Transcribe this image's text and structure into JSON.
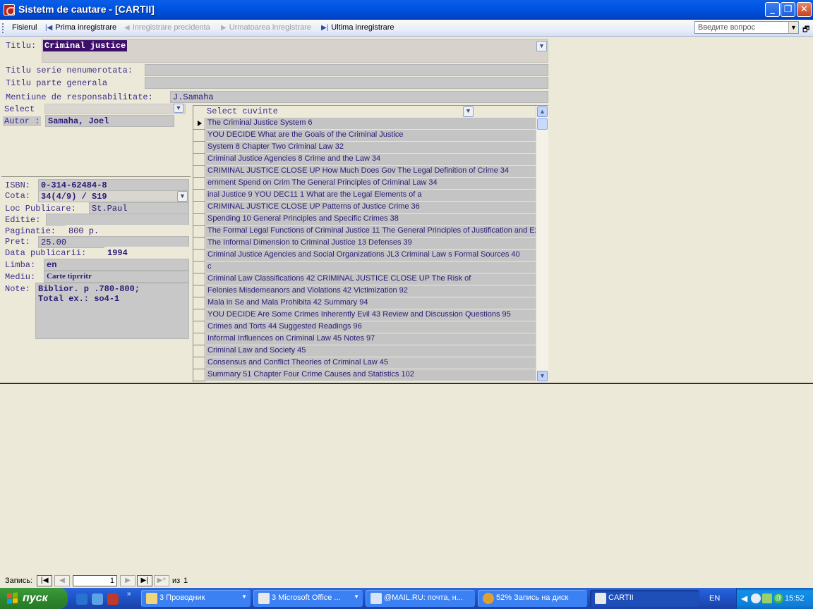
{
  "window": {
    "title": "Sistetm de cautare - [CARTII]"
  },
  "menu": {
    "fisierul": "Fisierul",
    "prima": "Prima inregistrare",
    "precedenta": "Inregistrare precidenta",
    "urmatoarea": "Urmatoarea inregistrare",
    "ultima": "Ultima inregistrare",
    "help_placeholder": "Введите вопрос"
  },
  "form": {
    "titlu_label": "Titlu:",
    "titlu_value": "Criminal justice",
    "serie_label": "Titlu serie nenumerotata:",
    "serie_value": "",
    "parte_label": "Titlu parte generala",
    "parte_value": "",
    "mentiune_label": "Mentiune de responsabilitate:",
    "mentiune_value": "J.Samaha",
    "select_label": "Select",
    "autor_label": "Autor :",
    "autor_value": "Samaha, Joel",
    "isbn_label": "ISBN:",
    "isbn_value": "0-314-62484-8",
    "cota_label": "Cota:",
    "cota_value": "34(4/9) / S19",
    "loc_label": "Loc Publicare:",
    "loc_value": "St.Paul",
    "editie_label": "Editie:",
    "editie_value": "",
    "paginatie_label": "Paginatie:",
    "paginatie_value": "800 p.",
    "pret_label": "Pret:",
    "pret_value": "25.00",
    "data_label": "Data publicarii:",
    "data_value": "1994",
    "limba_label": "Limba:",
    "limba_value": "en",
    "mediu_label": "Mediu:",
    "mediu_value": "Carte tiprritr",
    "note_label": "Note:",
    "note_line1": "Biblior. p .780-800;",
    "note_line2": "Total ex.: so4-1"
  },
  "keywords": {
    "header": "Select cuvinte",
    "rows": [
      "The Criminal Justice System 6",
      "YOU DECIDE What are the Goals of the Criminal Justice",
      "System 8 Chapter Two Criminal Law 32",
      "Criminal Justice Agencies 8 Crime and the Law 34",
      "CRIMINAL JUSTICE CLOSE UP How Much Does Gov  The Legal Definition of Crime 34",
      "ernment Spend on Crim  The General Principles of Criminal Law 34",
      "inal Justice 9 YOU DEC11 1 What are the Legal Elements of a",
      "CRIMINAL JUSTICE CLOSE UP Patterns of Justice Crime 36",
      "Spending 10 General Principles and Specific Crimes 38",
      "The Formal Legal Functions of Criminal Justice 11 The General Principles of Justification and Excuse",
      "The Informal Dimension to Criminal Justice 13 Defenses 39",
      "Criminal Justice Agencies and Social Organizations JL3 Criminal Law s Formal Sources 40",
      "c",
      "Criminal Law Classifications 42 CRIMINAL JUSTICE CLOSE UP The Risk of",
      "Felonies Misdemeanors and Violations 42 Victimization 92",
      "Mala in Se and Mala Prohibita 42 Summary 94",
      "YOU DECIDE Are Some Crimes Inherently Evil 43 Review and Discussion Questions 95",
      "Crimes and Torts 44 Suggested Readings 96",
      "Informal Influences on Criminal Law 45 Notes 97",
      "Criminal Law and Society 45",
      "Consensus and Conflict Theories of Criminal Law 45",
      "Summary 51 Chapter Four Crime Causes and Statistics 102"
    ]
  },
  "recnav": {
    "label": "Запись:",
    "current": "1",
    "of_label": "из",
    "total": "1"
  },
  "taskbar": {
    "start": "пуск",
    "tasks": [
      "3 Проводник",
      "3 Microsoft Office ...",
      "@MAIL.RU: почта, н...",
      "52% Запись на диск",
      "CARTII"
    ],
    "lang": "EN",
    "clock": "15:52"
  }
}
